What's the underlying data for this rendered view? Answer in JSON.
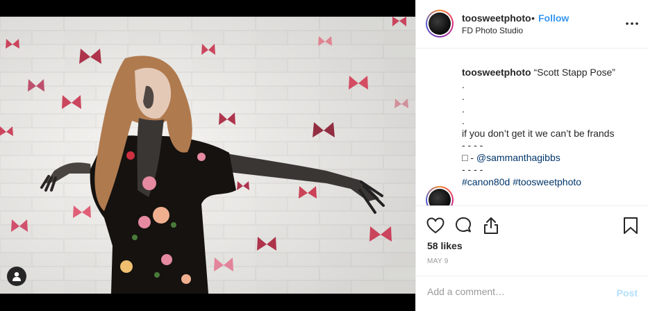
{
  "post": {
    "username": "toosweetphoto",
    "separator": "•",
    "follow_label": "Follow",
    "location": "FD Photo Studio",
    "more_icon": "more-options-icon"
  },
  "caption": {
    "username": "toosweetphoto",
    "title": "“Scott Stapp Pose”",
    "dots": [
      ".",
      ".",
      ".",
      "."
    ],
    "text_line": "if you don’t get it we can’t be frands",
    "dash_line_1": "- - - -",
    "credit_prefix": "□ - ",
    "credit_handle": "@sammanthagibbs",
    "dash_line_2": "- - - -",
    "hashtag_1": "#canon80d",
    "hashtag_2": "#toosweetphoto"
  },
  "actions": {
    "likes": "58 likes",
    "date": "MAY 9"
  },
  "comment_box": {
    "placeholder": "Add a comment…",
    "post_label": "Post"
  },
  "colors": {
    "link_blue": "#3897f0",
    "post_disabled": "#b2dffc",
    "text": "#262626"
  }
}
